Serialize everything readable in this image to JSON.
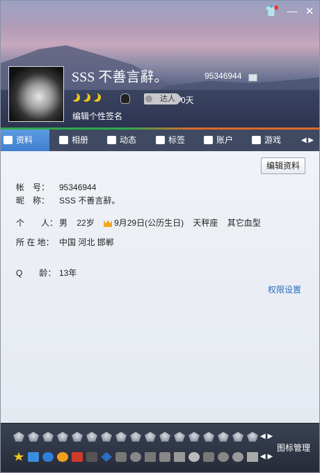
{
  "window": {
    "skin_icon": "shirt-icon",
    "minimize_glyph": "—",
    "close_glyph": "✕",
    "accent": "#3f7fd0"
  },
  "profile": {
    "nickname": "SSS 不善言辭。",
    "qq_number": "95346944",
    "talent_label": "达人",
    "days": "0天",
    "signature_placeholder": "编辑个性签名"
  },
  "tabs": [
    {
      "label": "资料",
      "icon": "id-card-icon",
      "active": true
    },
    {
      "label": "相册",
      "icon": "photo-icon",
      "active": false
    },
    {
      "label": "动态",
      "icon": "feed-icon",
      "active": false
    },
    {
      "label": "标签",
      "icon": "bookmark-icon",
      "active": false
    },
    {
      "label": "账户",
      "icon": "briefcase-icon",
      "active": false
    },
    {
      "label": "游戏",
      "icon": "game-icon",
      "active": false
    }
  ],
  "content": {
    "edit_button": "编辑资料",
    "account": {
      "label": "帐　号：",
      "value": "95346944"
    },
    "nick": {
      "label": "昵　称：",
      "value": "SSS 不善言辭。"
    },
    "person": {
      "label": "个　　人：",
      "gender": "男",
      "age": "22岁",
      "birthday": "9月29日(公历生日)",
      "zodiac": "天秤座",
      "blood": "其它血型"
    },
    "location": {
      "label": "所 在 地：",
      "value": "中国 河北 邯郸"
    },
    "qage": {
      "label": "Q　　龄：",
      "value": "13年"
    },
    "permissions": "权限设置"
  },
  "bottom": {
    "icon_manage": "图标管理"
  }
}
